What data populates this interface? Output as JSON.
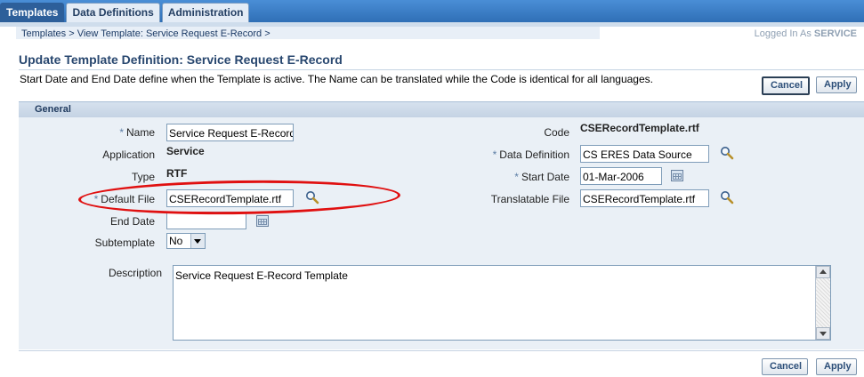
{
  "tabs": [
    {
      "label": "Templates",
      "active": true
    },
    {
      "label": "Data Definitions",
      "active": false
    },
    {
      "label": "Administration",
      "active": false
    }
  ],
  "breadcrumb": {
    "items": [
      "Templates",
      "View Template: Service Request E-Record"
    ],
    "separator": ">"
  },
  "logged_in": {
    "prefix": "Logged In As",
    "user": "SERVICE"
  },
  "page": {
    "title": "Update Template Definition: Service Request E-Record",
    "intro": "Start Date and End Date define when the Template is active. The Name can be translated while the Code is identical for all languages."
  },
  "buttons": {
    "cancel": "Cancel",
    "apply": "Apply"
  },
  "section": {
    "title": "General"
  },
  "form": {
    "name": {
      "label": "Name",
      "required": true,
      "value": "Service Request E-Record"
    },
    "application": {
      "label": "Application",
      "value": "Service"
    },
    "type": {
      "label": "Type",
      "value": "RTF"
    },
    "default_file": {
      "label": "Default File",
      "required": true,
      "value": "CSERecordTemplate.rtf"
    },
    "end_date": {
      "label": "End Date",
      "value": ""
    },
    "subtemplate": {
      "label": "Subtemplate",
      "value": "No"
    },
    "description": {
      "label": "Description",
      "value": "Service Request E-Record Template"
    },
    "code": {
      "label": "Code",
      "value": "CSERecordTemplate.rtf"
    },
    "data_definition": {
      "label": "Data Definition",
      "required": true,
      "value": "CS ERES Data Source"
    },
    "start_date": {
      "label": "Start Date",
      "required": true,
      "value": "01-Mar-2006"
    },
    "translatable_file": {
      "label": "Translatable File",
      "value": "CSERecordTemplate.rtf"
    }
  },
  "colors": {
    "tab_bar": "#2f6fb6",
    "title": "#28476f",
    "highlight_ellipse": "#e01010"
  },
  "icons": {
    "search": "magnifier-icon",
    "calendar": "calendar-icon"
  }
}
